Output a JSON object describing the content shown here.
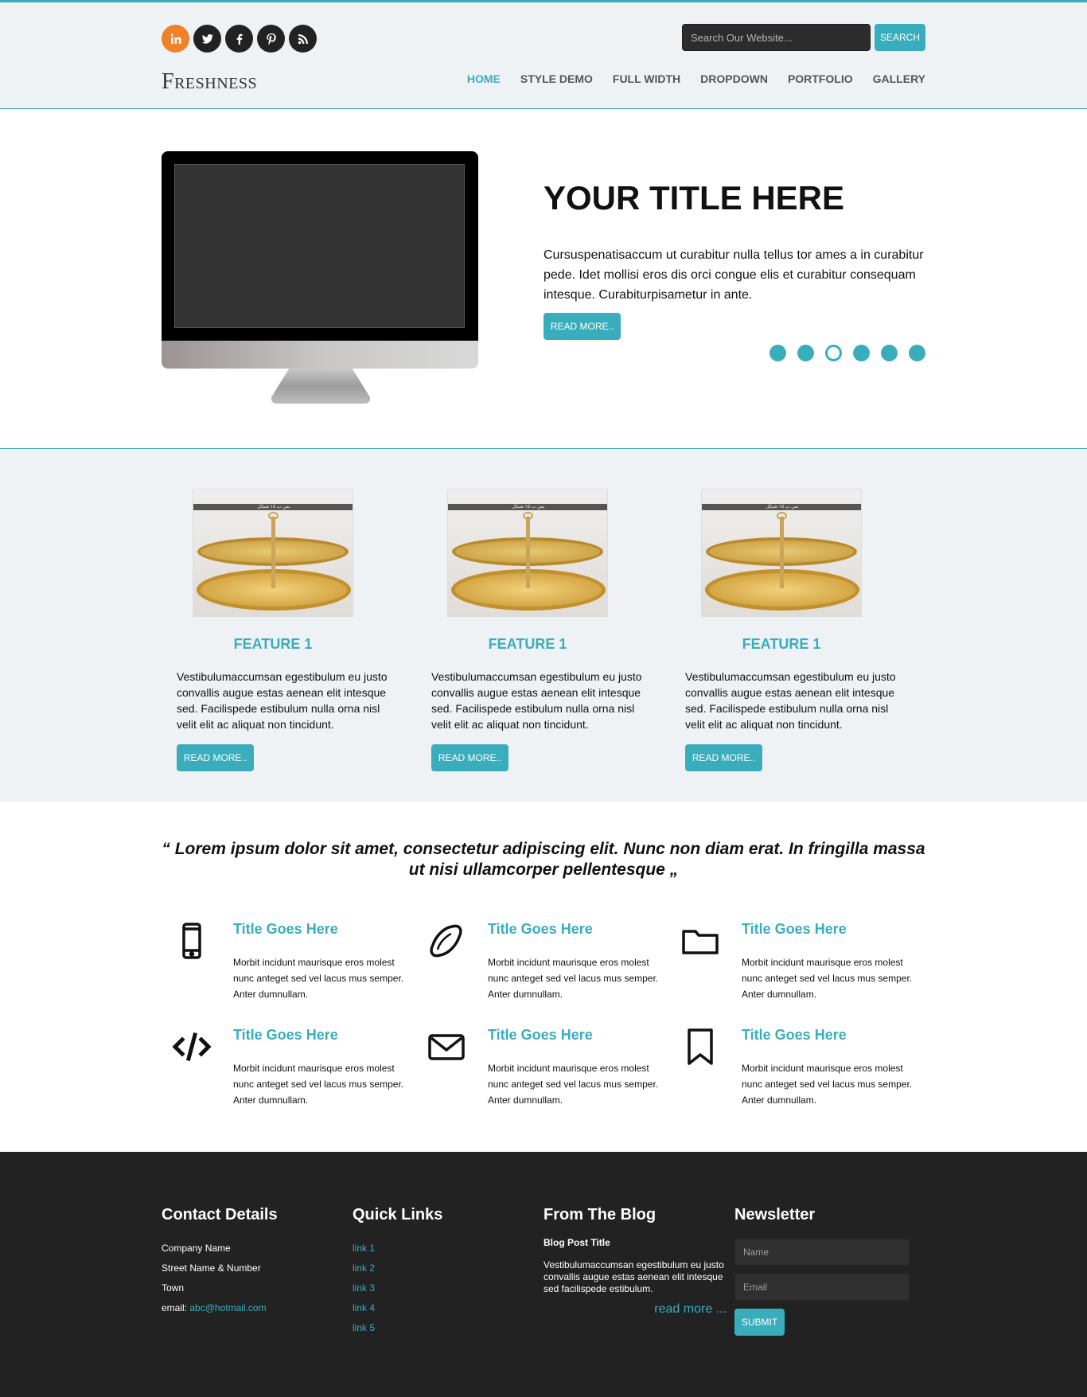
{
  "header": {
    "logo": "Freshness",
    "search": {
      "placeholder": "Search Our Website...",
      "button": "SEARCH"
    },
    "social": [
      "linkedin-icon",
      "twitter-icon",
      "facebook-icon",
      "pinterest-icon",
      "rss-icon"
    ],
    "nav": [
      {
        "label": "HOME",
        "active": true
      },
      {
        "label": "STYLE DEMO",
        "active": false
      },
      {
        "label": "FULL WIDTH",
        "active": false
      },
      {
        "label": "DROPDOWN",
        "active": false
      },
      {
        "label": "PORTFOLIO",
        "active": false
      },
      {
        "label": "GALLERY",
        "active": false
      }
    ]
  },
  "hero": {
    "title": "YOUR TITLE HERE",
    "text": "Cursuspenatisaccum ut curabitur nulla tellus tor ames a in curabitur pede. Idet mollisi eros dis orci congue elis et curabitur consequam intesque. Curabiturpisametur in ante.",
    "button": "READ MORE..",
    "slides": 6,
    "active_slide": 3
  },
  "features": [
    {
      "title": "FEATURE 1",
      "image_caption": "بس ب ١٥ شيكل",
      "text": "Vestibulumaccumsan egestibulum eu justo convallis augue estas aenean elit intesque sed. Facilispede estibulum nulla orna nisl velit elit ac aliquat non tincidunt.",
      "button": "READ MORE.."
    },
    {
      "title": "FEATURE 1",
      "image_caption": "بس ب ١٥ شيكل",
      "text": "Vestibulumaccumsan egestibulum eu justo convallis augue estas aenean elit intesque sed. Facilispede estibulum nulla orna nisl velit elit ac aliquat non tincidunt.",
      "button": "READ MORE.."
    },
    {
      "title": "FEATURE 1",
      "image_caption": "بس ب ١٥ شيكل",
      "text": "Vestibulumaccumsan egestibulum eu justo convallis augue estas aenean elit intesque sed. Facilispede estibulum nulla orna nisl velit elit ac aliquat non tincidunt.",
      "button": "READ MORE.."
    }
  ],
  "quote": "“ Lorem ipsum dolor sit amet, consectetur adipiscing elit. Nunc non diam erat. In fringilla massa ut nisi ullamcorper pellentesque „",
  "services": [
    {
      "icon": "mobile-phone-icon",
      "title": "Title Goes Here",
      "text": "Morbit incidunt maurisque eros molest nunc anteget sed vel lacus mus semper. Anter dumnullam."
    },
    {
      "icon": "lemon-icon",
      "title": "Title Goes Here",
      "text": "Morbit incidunt maurisque eros molest nunc anteget sed vel lacus mus semper. Anter dumnullam."
    },
    {
      "icon": "folder-icon",
      "title": "Title Goes Here",
      "text": "Morbit incidunt maurisque eros molest nunc anteget sed vel lacus mus semper. Anter dumnullam."
    },
    {
      "icon": "code-icon",
      "title": "Title Goes Here",
      "text": "Morbit incidunt maurisque eros molest nunc anteget sed vel lacus mus semper. Anter dumnullam."
    },
    {
      "icon": "envelope-icon",
      "title": "Title Goes Here",
      "text": "Morbit incidunt maurisque eros molest nunc anteget sed vel lacus mus semper. Anter dumnullam."
    },
    {
      "icon": "bookmark-icon",
      "title": "Title Goes Here",
      "text": "Morbit incidunt maurisque eros molest nunc anteget sed vel lacus mus semper. Anter dumnullam."
    }
  ],
  "footer": {
    "contact": {
      "title": "Contact Details",
      "company": "Company Name",
      "street": "Street Name & Number",
      "town": "Town",
      "email_label": "email:",
      "email": "abc@hotmail.com"
    },
    "links": {
      "title": "Quick Links",
      "items": [
        "link 1",
        "link 2",
        "link 3",
        "link 4",
        "link 5"
      ]
    },
    "blog": {
      "title": "From The Blog",
      "post_title": "Blog Post Title",
      "post_text": "Vestibulumaccumsan egestibulum eu justo convallis augue estas aenean elit intesque sed facilispede estibulum.",
      "read_more": "read more ..."
    },
    "newsletter": {
      "title": "Newsletter",
      "name_placeholder": "Name",
      "email_placeholder": "Email",
      "button": "SUBMIT"
    }
  },
  "colors": {
    "accent": "#3aadbd",
    "linkedin": "#ee8129",
    "dark": "#222222",
    "light_bg": "#eef2f5"
  }
}
